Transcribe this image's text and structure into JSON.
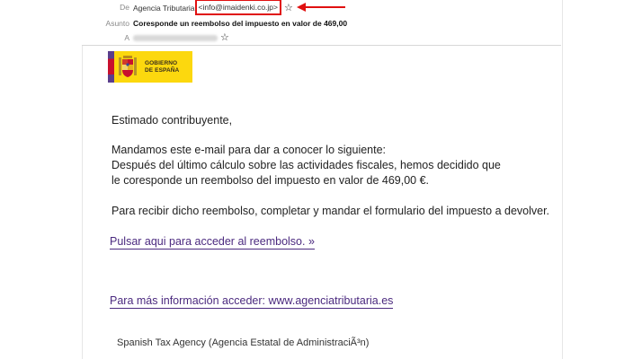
{
  "email_header": {
    "from_label": "De",
    "from_name": "Agencia Tributaria",
    "from_address": "<info@imaidenki.co.jp>",
    "subject_label": "Asunto",
    "subject": "Coresponde un reembolso del impuesto en valor de 469,00",
    "to_label": "A"
  },
  "logo": {
    "line1": "GOBIERNO",
    "line2": "DE ESPAÑA"
  },
  "body": {
    "greeting": "Estimado contribuyente,",
    "para1_line1": "Mandamos este e-mail para dar a conocer lo siguiente:",
    "para1_line2": "Después del último cálculo sobre las actividades fiscales, hemos decidido que",
    "para1_line3": "le coresponde un reembolso del impuesto en valor de 469,00 €.",
    "para2": "Para recibir dicho reembolso, completar y mandar el formulario del impuesto a devolver.",
    "refund_link": "Pulsar aqui para acceder al reembolso.  »",
    "info_link": "Para más información acceder: www.agenciatributaria.es",
    "footer": "Spanish Tax Agency (Agencia Estatal de AdministraciÃ³n)"
  },
  "colors": {
    "annotation_red": "#e01010",
    "link_purple": "#4b2a7f",
    "logo_yellow": "#fcd80e"
  }
}
